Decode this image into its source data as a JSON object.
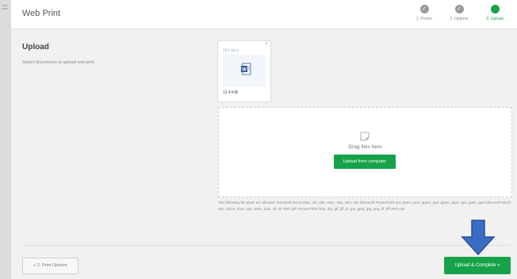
{
  "header": {
    "title": "Web Print",
    "steps": [
      {
        "label": "1. Printer",
        "status": "done"
      },
      {
        "label": "2. Options",
        "status": "done"
      },
      {
        "label": "3. Upload",
        "status": "active"
      }
    ]
  },
  "upload": {
    "title": "Upload",
    "subtitle": "Select documents to upload and print"
  },
  "file": {
    "name": "164.docx",
    "size": "12.4 KiB",
    "close": "×"
  },
  "dropzone": {
    "text": "Drag files here",
    "button": "Upload from computer"
  },
  "filetypes_text": "The following file types are allowed: Microsoft Excel xlam, xls, xlsb, xlsm, xlsx, xltm, xltx Microsoft PowerPoint pot, potm, potx, ppam, pps, ppsm, ppsx, ppt, pptm, pptx Microsoft Word doc, docm, docx, dot, dotm, dotx, rtf, txt PDF pdf Picture Files bmp, dib, gif, jfif, jif, jpe, jpeg, jpg, png, tif, tiff XPS xps",
  "footer": {
    "back": "« 2. Print Options",
    "next": "Upload & Complete »"
  },
  "colors": {
    "accent": "#17a24a",
    "arrow": "#3b6cc4",
    "step_done": "#9a9a9a"
  }
}
